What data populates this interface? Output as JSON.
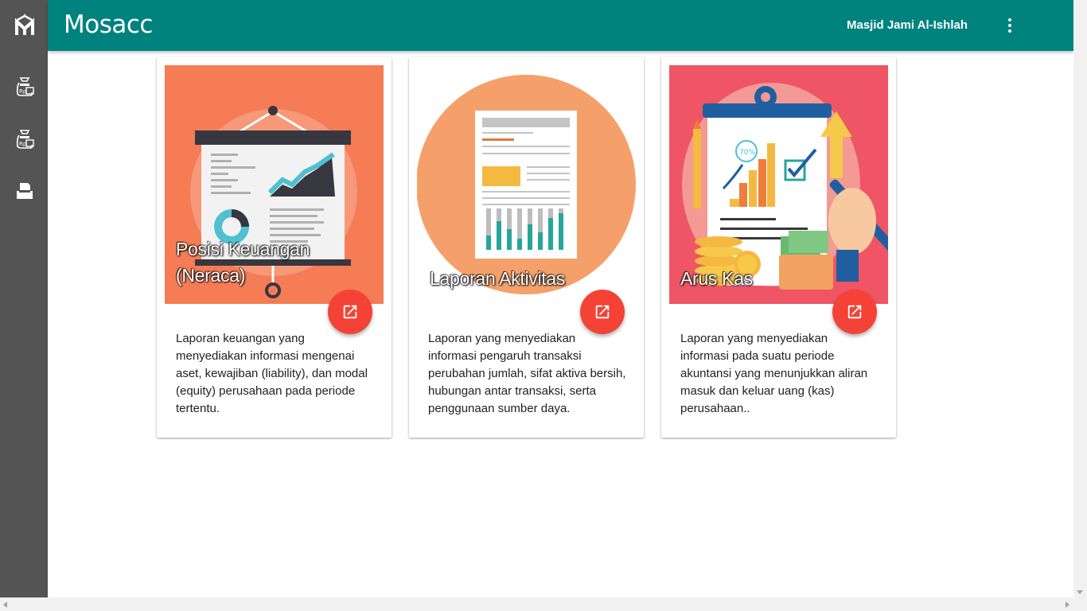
{
  "app": {
    "title": "Mosacc"
  },
  "header": {
    "organization": "Masjid Jami Al-Ishlah"
  },
  "sidebar": {
    "icons": [
      "mosacc-logo-icon",
      "money-bag-icon",
      "money-bag-icon",
      "printer-icon"
    ]
  },
  "cards": [
    {
      "title_line1": "Posisi Keuangan",
      "title_line2": "(Neraca)",
      "description": "Laporan keuangan yang menyediakan informasi mengenai aset, kewajiban (liability), dan modal (equity) perusahaan pada periode tertentu."
    },
    {
      "title_line1": "Laporan Aktivitas",
      "description": "Laporan yang menyediakan informasi pengaruh transaksi perubahan jumlah, sifat aktiva bersih, hubungan antar transaksi, serta penggunaan sumber daya."
    },
    {
      "title_line1": "Arus Kas",
      "description": "Laporan yang menyediakan informasi pada suatu periode akuntansi yang menunjukkan aliran masuk dan keluar uang (kas) perusahaan.."
    }
  ],
  "illustrations": {
    "chart_badge": "70%"
  },
  "colors": {
    "header": "#00827f",
    "sidebar": "#545454",
    "fab": "#f44336",
    "card1_bg": "#f57c55",
    "card2_circle": "#f5a06a",
    "card3_bg": "#ef5564"
  }
}
